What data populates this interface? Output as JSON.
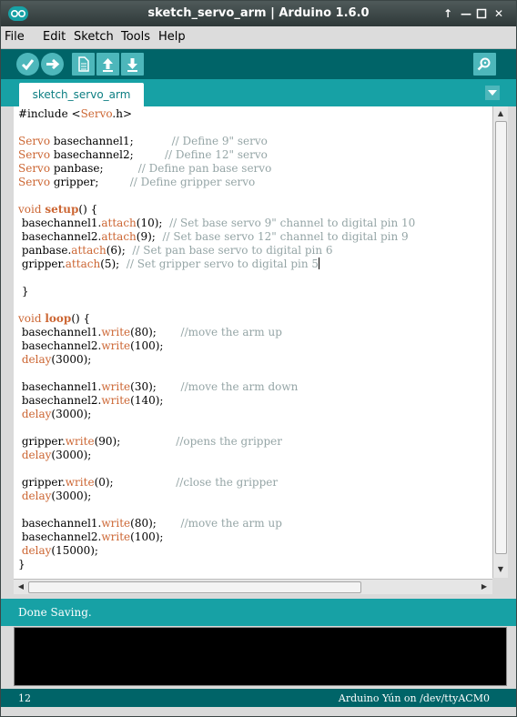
{
  "window": {
    "title": "sketch_servo_arm | Arduino 1.6.0"
  },
  "menu": [
    "File",
    "Edit",
    "Sketch",
    "Tools",
    "Help"
  ],
  "tabs": [
    {
      "label": "sketch_servo_arm"
    }
  ],
  "icons": {
    "app": "arduino-logo-icon",
    "verify": "check-icon",
    "upload": "arrow-right-icon",
    "new": "document-icon",
    "open": "arrow-up-icon",
    "save": "arrow-down-icon",
    "serial_monitor": "magnifier-icon",
    "tab_menu": "chevron-down-icon"
  },
  "colors": {
    "teal_dark": "#006468",
    "teal": "#17a1a5",
    "button": "#4db7bb",
    "keyword": "#cc6633",
    "comment": "#95a5a6"
  },
  "editor": {
    "lines": [
      [
        [
          "#include <",
          ""
        ],
        [
          "Servo",
          "k"
        ],
        [
          ".h>",
          ""
        ]
      ],
      [],
      [
        [
          "Servo",
          "k"
        ],
        [
          " basechannel1;           ",
          ""
        ],
        [
          "// Define 9\" servo",
          "c"
        ]
      ],
      [
        [
          "Servo",
          "k"
        ],
        [
          " basechannel2;         ",
          ""
        ],
        [
          "// Define 12\" servo",
          "c"
        ]
      ],
      [
        [
          "Servo",
          "k"
        ],
        [
          " panbase;          ",
          ""
        ],
        [
          "// Define pan base servo",
          "c"
        ]
      ],
      [
        [
          "Servo",
          "k"
        ],
        [
          " gripper;         ",
          ""
        ],
        [
          "// Define gripper servo",
          "c"
        ]
      ],
      [],
      [
        [
          "void",
          "k"
        ],
        [
          " ",
          ""
        ],
        [
          "setup",
          "kb"
        ],
        [
          "() {",
          ""
        ]
      ],
      [
        [
          " basechannel1.",
          ""
        ],
        [
          "attach",
          "k"
        ],
        [
          "(10);  ",
          ""
        ],
        [
          "// Set base servo 9\" channel to digital pin 10",
          "c"
        ]
      ],
      [
        [
          " basechannel2.",
          ""
        ],
        [
          "attach",
          "k"
        ],
        [
          "(9);  ",
          ""
        ],
        [
          "// Set base servo 12\" channel to digital pin 9",
          "c"
        ]
      ],
      [
        [
          " panbase.",
          ""
        ],
        [
          "attach",
          "k"
        ],
        [
          "(6);  ",
          ""
        ],
        [
          "// Set pan base servo to digital pin 6",
          "c"
        ]
      ],
      [
        [
          " gripper.",
          ""
        ],
        [
          "attach",
          "k"
        ],
        [
          "(5);  ",
          ""
        ],
        [
          "// Set gripper servo to digital pin 5",
          "c"
        ],
        [
          "",
          "cursor"
        ]
      ],
      [],
      [
        [
          " }",
          ""
        ]
      ],
      [],
      [
        [
          "void",
          "k"
        ],
        [
          " ",
          ""
        ],
        [
          "loop",
          "kb"
        ],
        [
          "() {",
          ""
        ]
      ],
      [
        [
          " basechannel1.",
          ""
        ],
        [
          "write",
          "k"
        ],
        [
          "(80);       ",
          ""
        ],
        [
          "//move the arm up",
          "c"
        ]
      ],
      [
        [
          " basechannel2.",
          ""
        ],
        [
          "write",
          "k"
        ],
        [
          "(100);",
          ""
        ]
      ],
      [
        [
          " ",
          ""
        ],
        [
          "delay",
          "k"
        ],
        [
          "(3000);",
          ""
        ]
      ],
      [],
      [
        [
          " basechannel1.",
          ""
        ],
        [
          "write",
          "k"
        ],
        [
          "(30);       ",
          ""
        ],
        [
          "//move the arm down",
          "c"
        ]
      ],
      [
        [
          " basechannel2.",
          ""
        ],
        [
          "write",
          "k"
        ],
        [
          "(140);",
          ""
        ]
      ],
      [
        [
          " ",
          ""
        ],
        [
          "delay",
          "k"
        ],
        [
          "(3000);",
          ""
        ]
      ],
      [],
      [
        [
          " gripper.",
          ""
        ],
        [
          "write",
          "k"
        ],
        [
          "(90);                ",
          ""
        ],
        [
          "//opens the gripper",
          "c"
        ]
      ],
      [
        [
          " ",
          ""
        ],
        [
          "delay",
          "k"
        ],
        [
          "(3000);",
          ""
        ]
      ],
      [],
      [
        [
          " gripper.",
          ""
        ],
        [
          "write",
          "k"
        ],
        [
          "(0);                  ",
          ""
        ],
        [
          "//close the gripper",
          "c"
        ]
      ],
      [
        [
          " ",
          ""
        ],
        [
          "delay",
          "k"
        ],
        [
          "(3000);",
          ""
        ]
      ],
      [],
      [
        [
          " basechannel1.",
          ""
        ],
        [
          "write",
          "k"
        ],
        [
          "(80);       ",
          ""
        ],
        [
          "//move the arm up",
          "c"
        ]
      ],
      [
        [
          " basechannel2.",
          ""
        ],
        [
          "write",
          "k"
        ],
        [
          "(100);",
          ""
        ]
      ],
      [
        [
          " ",
          ""
        ],
        [
          "delay",
          "k"
        ],
        [
          "(15000);",
          ""
        ]
      ],
      [
        [
          "}",
          ""
        ]
      ]
    ]
  },
  "status": {
    "message": "Done Saving."
  },
  "footer": {
    "line": "12",
    "board": "Arduino Yún on /dev/ttyACM0"
  }
}
